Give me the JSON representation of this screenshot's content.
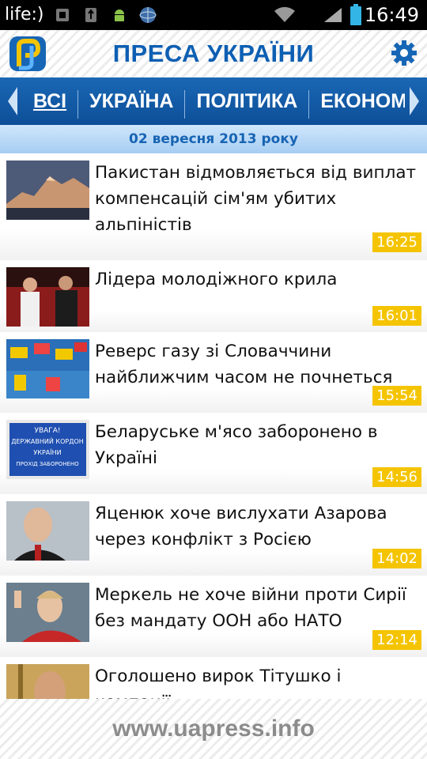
{
  "status_bar": {
    "carrier": "life:)",
    "time": "16:49",
    "icons": [
      "usb-debug-icon",
      "usb-icon",
      "android-icon",
      "globe-icon",
      "wifi-icon",
      "signal-icon",
      "battery-icon"
    ]
  },
  "header": {
    "title": "ПРЕСА УКРАЇНИ",
    "accent_color": "#0d5fb3"
  },
  "tabs": [
    {
      "label": "ВСІ",
      "active": true
    },
    {
      "label": "УКРАЇНА",
      "active": false
    },
    {
      "label": "ПОЛІТИКА",
      "active": false
    },
    {
      "label": "ЕКОНОМІ",
      "active": false
    }
  ],
  "date": "02 вересня 2013 року",
  "news": [
    {
      "title": "Пакистан відмовляється від виплат компенсацій сім'ям убитих альпіністів",
      "time": "16:25",
      "thumb": "mountain"
    },
    {
      "title": "Лідера молодіжного крила",
      "time": "16:01",
      "thumb": "people"
    },
    {
      "title": "Реверс газу зі Словаччини найближчим часом не почнеться",
      "time": "15:54",
      "thumb": "flags"
    },
    {
      "title": "Беларуське м'ясо заборонено в Україні",
      "time": "14:56",
      "thumb": "sign"
    },
    {
      "title": "Яценюк хоче вислухати Азарова через конфлікт з Росією",
      "time": "14:02",
      "thumb": "portrait"
    },
    {
      "title": "Меркель не хоче війни проти Сирії без мандату ООН або НАТО",
      "time": "12:14",
      "thumb": "speaker"
    },
    {
      "title": "Оголошено вирок Тітушко і компанії",
      "time": "",
      "thumb": "person"
    }
  ],
  "thumb_sign_text": [
    "УВАГА!",
    "ДЕРЖАВНИЙ КОРДОН",
    "УКРАЇНИ",
    "ПРОХІД ЗАБОРОНЕНО"
  ],
  "footer": {
    "text": "www.uapress.info"
  },
  "colors": {
    "badge": "#f5c400",
    "tab_bar": "#1a67b5",
    "date_bar": "#a6cdf3"
  }
}
